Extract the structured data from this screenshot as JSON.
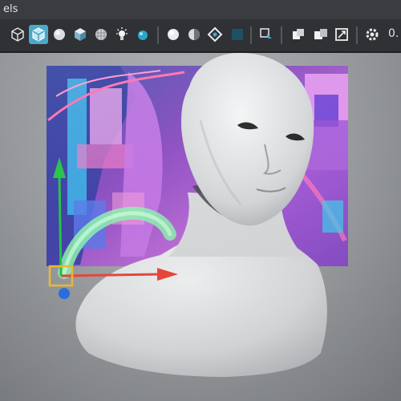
{
  "app": {
    "menu_fragment": "els",
    "shelf_trailing_text": "0."
  },
  "shelf": {
    "tools": [
      {
        "icon": "cube-wireframe-icon"
      },
      {
        "icon": "cube-selected-icon",
        "active": true
      },
      {
        "icon": "sphere-icon"
      },
      {
        "icon": "cube-shaded-icon"
      },
      {
        "icon": "sphere-textured-icon"
      },
      {
        "icon": "light-bulb-icon"
      },
      {
        "icon": "sphere-blue-icon"
      },
      {
        "icon": "shading-sphere-icon"
      },
      {
        "icon": "shading-split-sphere-icon"
      },
      {
        "icon": "isolate-diamond-icon"
      },
      {
        "icon": "grid-square-icon"
      },
      {
        "icon": "select-arrow-icon"
      },
      {
        "icon": "layout-single-icon"
      },
      {
        "icon": "layout-double-icon"
      },
      {
        "icon": "camera-frame-icon"
      },
      {
        "icon": "gear-icon"
      }
    ]
  },
  "scene": {
    "model": "head-bust",
    "background_image": "cyberpunk-illustration",
    "gizmo": "move-manipulator",
    "curve": "spline-curve"
  },
  "colors": {
    "toolbar_bg": "#2f3134",
    "active_tool": "#4aa9c8",
    "viewport_bg": "#a7aaad",
    "axis_x": "#e8483b",
    "axis_y": "#22c447",
    "axis_z": "#2b6fe0",
    "pivot": "#f0b930",
    "curve": "#8ef0b0",
    "bust": "#dfe1e3"
  }
}
